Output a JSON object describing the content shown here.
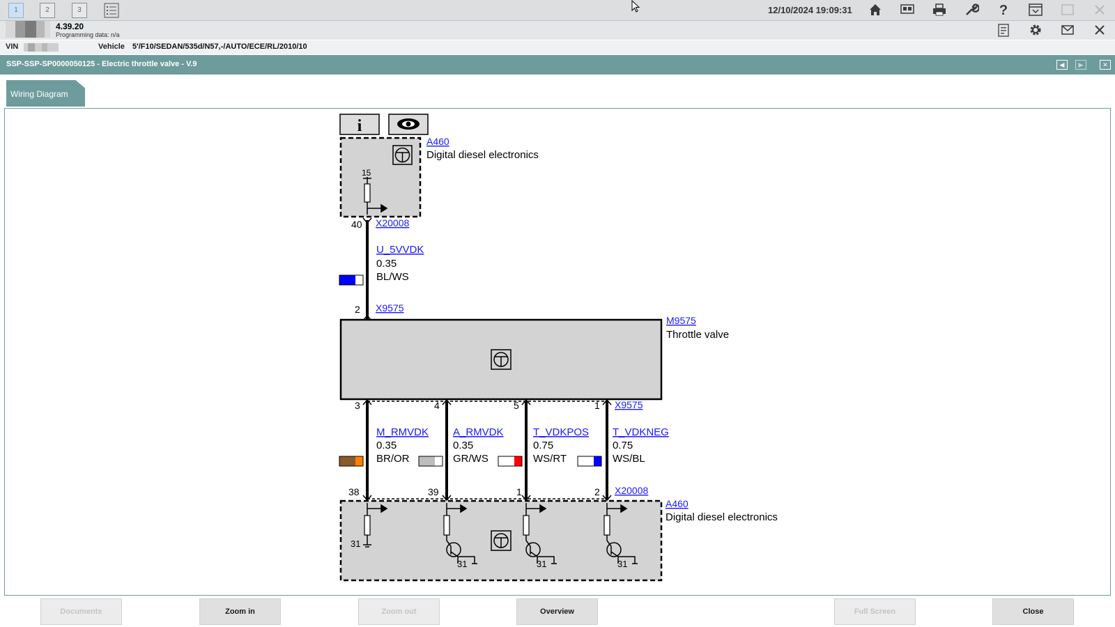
{
  "topbar": {
    "windows": [
      "1",
      "2",
      "3"
    ],
    "datetime": "12/10/2024 19:09:31",
    "icons": [
      "home-icon",
      "compare-icon",
      "print-icon",
      "wrench-icon",
      "help-icon",
      "minimize-icon",
      "restore-icon",
      "close-icon"
    ]
  },
  "session": {
    "version": "4.39.20",
    "programming_data": "Programming data:  n/a",
    "vin_label": "VIN",
    "vehicle_label": "Vehicle",
    "vehicle_value": "5'/F10/SEDAN/535d/N57,-/AUTO/ECE/RL/2010/10"
  },
  "document": {
    "title": "SSP-SSP-SP0000050125 - Electric throttle valve - V.9",
    "tab_label": "Wiring Diagram"
  },
  "diagram": {
    "top_component": {
      "id": "A460",
      "name": "Digital diesel electronics",
      "pin_label": "15"
    },
    "top_connector": {
      "id": "X20008",
      "pin": "40"
    },
    "supply_wire": {
      "signal": "U_5VVDK",
      "gauge": "0.35",
      "color_code": "BL/WS",
      "colors": [
        "#0000ff",
        "#ffffff"
      ]
    },
    "valve_connector_top": {
      "id": "X9575",
      "pin": "2"
    },
    "valve": {
      "id": "M9575",
      "name": "Throttle valve"
    },
    "valve_connector_bottom": {
      "id": "X9575",
      "pins": [
        "3",
        "4",
        "5",
        "1"
      ]
    },
    "wires": [
      {
        "signal": "M_RMVDK",
        "gauge": "0.35",
        "color_code": "BR/OR",
        "colors": [
          "#8b5a2b",
          "#ff8000"
        ]
      },
      {
        "signal": "A_RMVDK",
        "gauge": "0.35",
        "color_code": "GR/WS",
        "colors": [
          "#bdbdbd",
          "#ffffff"
        ]
      },
      {
        "signal": "T_VDKPOS",
        "gauge": "0.75",
        "color_code": "WS/RT",
        "colors": [
          "#ffffff",
          "#ff0000"
        ]
      },
      {
        "signal": "T_VDKNEG",
        "gauge": "0.75",
        "color_code": "WS/BL",
        "colors": [
          "#ffffff",
          "#0000ff"
        ]
      }
    ],
    "bottom_connector": {
      "id": "X20008",
      "pins": [
        "38",
        "39",
        "1",
        "2"
      ]
    },
    "bottom_component": {
      "id": "A460",
      "name": "Digital diesel electronics",
      "ground_labels": [
        "31",
        "31",
        "31",
        "31"
      ]
    }
  },
  "bottom_buttons": {
    "documents": "Documents",
    "zoom_in": "Zoom in",
    "zoom_out": "Zoom out",
    "overview": "Overview",
    "full_screen": "Full Screen",
    "close": "Close"
  },
  "colors": {
    "accent_teal": "#6e9c9c",
    "link_blue": "#1a1aff",
    "component_gray": "#d3d3d3"
  }
}
